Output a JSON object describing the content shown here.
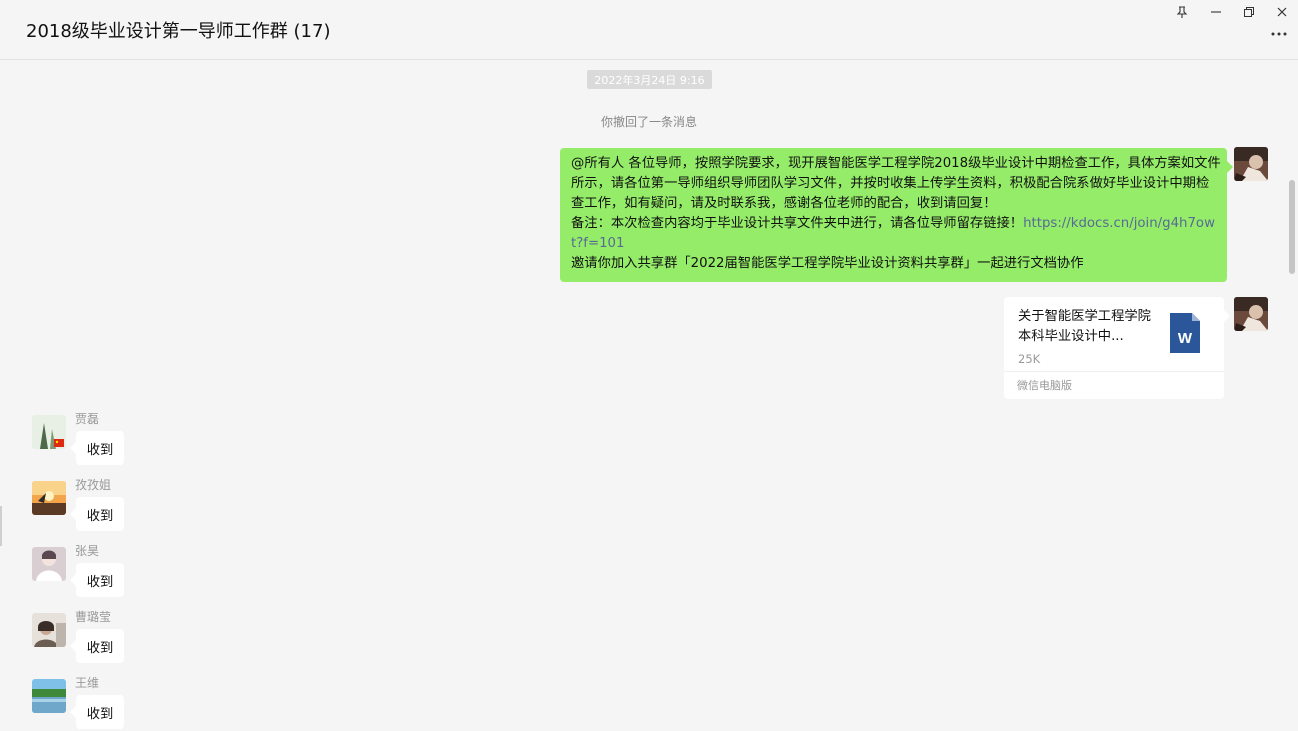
{
  "window": {
    "title": "2018级毕业设计第一导师工作群 (17)"
  },
  "chat": {
    "timestamp": "2022年3月24日 9:16",
    "system_message": "你撤回了一条消息",
    "sent_message": {
      "lines": [
        "@所有人 各位导师，按照学院要求，现开展智能医学工程学院2018级毕业设计中期检查工作，具体方案如文件所示，请各位第一导师组织导师团队学习文件，并按时收集上传学生资料，积极配合院系做好毕业设计中期检查工作，如有疑问，请及时联系我，感谢各位老师的配合，收到请回复！"
      ],
      "note_text": "备注：本次检查内容均于毕业设计共享文件夹中进行，请各位导师留存链接！",
      "link": "https://kdocs.cn/join/g4h7owt?f=101",
      "invite_text": "邀请你加入共享群「2022届智能医学工程学院毕业设计资料共享群」一起进行文档协作"
    },
    "file_message": {
      "name": "关于智能医学工程学院本科毕业设计中...",
      "size": "25K",
      "source": "微信电脑版",
      "icon_letter": "W"
    },
    "replies": [
      {
        "sender": "贾磊",
        "text": "收到"
      },
      {
        "sender": "孜孜姐",
        "text": "收到"
      },
      {
        "sender": "张昊",
        "text": "收到"
      },
      {
        "sender": "曹璐莹",
        "text": "收到"
      },
      {
        "sender": "王维",
        "text": "收到"
      }
    ]
  },
  "colors": {
    "sent_bubble": "#95ec69",
    "link": "#576b95",
    "word_icon": "#2b579a"
  },
  "icons": [
    "pin-icon",
    "minimize-icon",
    "restore-icon",
    "close-icon",
    "more-icon",
    "word-file-icon"
  ]
}
